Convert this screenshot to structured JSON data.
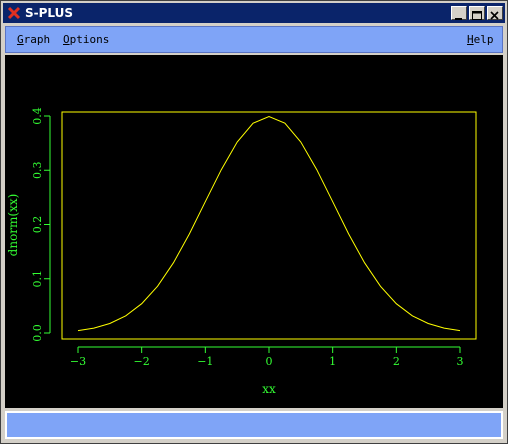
{
  "window": {
    "title": "S-PLUS"
  },
  "menubar": {
    "items": [
      {
        "label": "Graph",
        "underline": "G",
        "rest": "raph"
      },
      {
        "label": "Options",
        "underline": "O",
        "rest": "ptions"
      }
    ],
    "help": {
      "label": "Help",
      "underline": "H",
      "rest": "elp"
    }
  },
  "colors": {
    "plot_bg": "#000000",
    "axis_text": "#33ff33",
    "curve": "#ffff00",
    "frame": "#ffff00",
    "menubar": "#7fa4f7",
    "titlebar": "#0a246a"
  },
  "chart_data": {
    "type": "line",
    "xlabel": "xx",
    "ylabel": "dnorm(xx)",
    "xlim": [
      -3,
      3
    ],
    "ylim": [
      0,
      0.4
    ],
    "xticks": [
      "−3",
      "−2",
      "−1",
      "0",
      "1",
      "2",
      "3"
    ],
    "yticks": [
      "0.0",
      "0.1",
      "0.2",
      "0.3",
      "0.4"
    ],
    "grid": false,
    "x": [
      -3.0,
      -2.75,
      -2.5,
      -2.25,
      -2.0,
      -1.75,
      -1.5,
      -1.25,
      -1.0,
      -0.75,
      -0.5,
      -0.25,
      0.0,
      0.25,
      0.5,
      0.75,
      1.0,
      1.25,
      1.5,
      1.75,
      2.0,
      2.25,
      2.5,
      2.75,
      3.0
    ],
    "y": [
      0.0044,
      0.0091,
      0.0175,
      0.0317,
      0.054,
      0.0863,
      0.1295,
      0.1826,
      0.242,
      0.3011,
      0.3521,
      0.3867,
      0.3989,
      0.3867,
      0.3521,
      0.3011,
      0.242,
      0.1826,
      0.1295,
      0.0863,
      0.054,
      0.0317,
      0.0175,
      0.0091,
      0.0044
    ]
  }
}
